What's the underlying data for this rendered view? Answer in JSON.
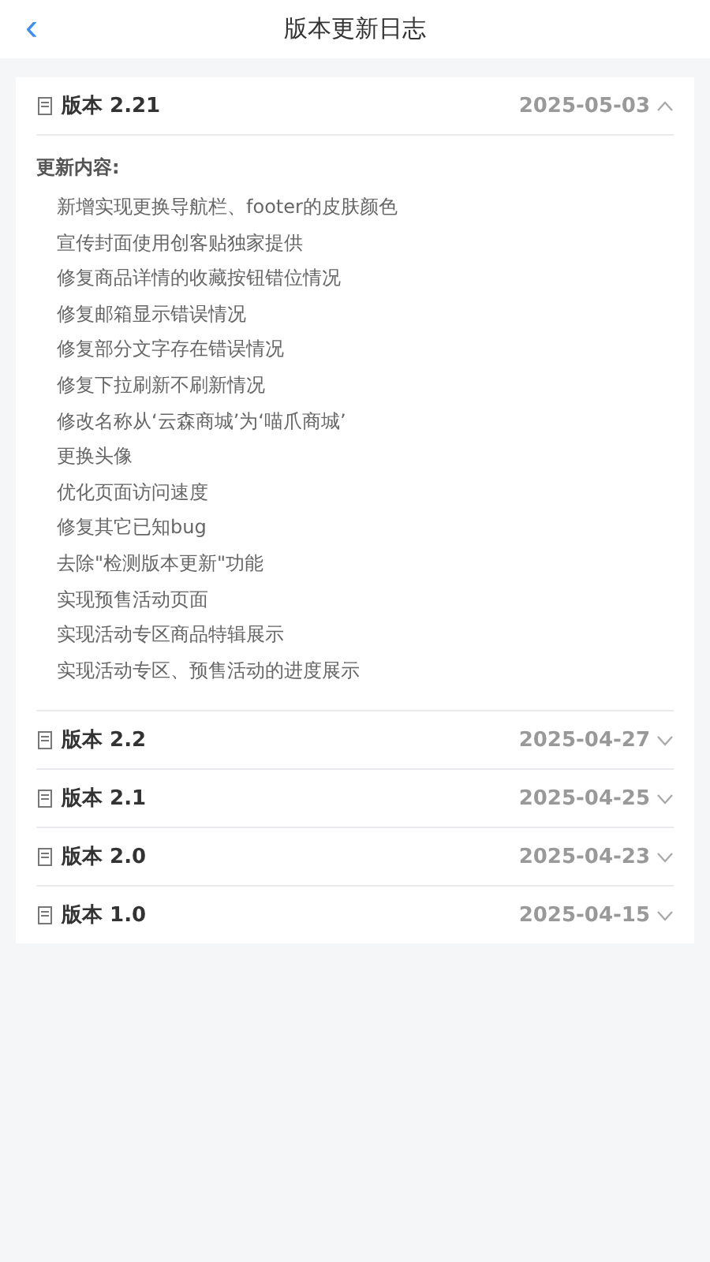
{
  "nav": {
    "back": "‹",
    "title": "版本更新日志"
  },
  "versions": [
    {
      "title": "版本 2.21",
      "date": "2025-05-03",
      "expanded": true,
      "heading": "更新内容:",
      "items": [
        "新增实现更换导航栏、footer的皮肤颜色",
        "宣传封面使用创客贴独家提供",
        "修复商品详情的收藏按钮错位情况",
        "修复邮箱显示错误情况",
        "修复部分文字存在错误情况",
        "修复下拉刷新不刷新情况",
        "修改名称从‘云森商城’为‘喵爪商城’",
        "更换头像",
        "优化页面访问速度",
        "修复其它已知bug",
        "去除\"检测版本更新\"功能",
        "实现预售活动页面",
        "实现活动专区商品特辑展示",
        "实现活动专区、预售活动的进度展示"
      ]
    },
    {
      "title": "版本 2.2",
      "date": "2025-04-27",
      "expanded": false
    },
    {
      "title": "版本 2.1",
      "date": "2025-04-25",
      "expanded": false
    },
    {
      "title": "版本 2.0",
      "date": "2025-04-23",
      "expanded": false
    },
    {
      "title": "版本 1.0",
      "date": "2025-04-15",
      "expanded": false
    }
  ]
}
